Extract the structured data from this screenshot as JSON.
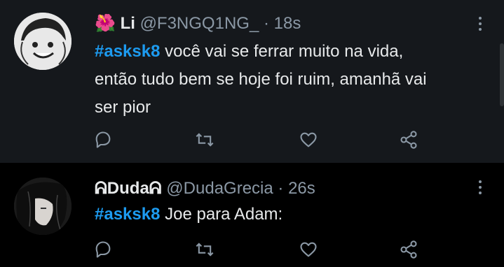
{
  "tweets": [
    {
      "emoji": "🌺",
      "display_name": "Li",
      "handle": "@F3NGQ1NG_",
      "separator": "·",
      "time": "18s",
      "hashtag": "#asksk8",
      "lines": [
        "você vai se ferrar muito na vida,",
        "então tudo bem se hoje foi ruim, amanhã vai",
        "ser pior"
      ]
    },
    {
      "display_name": "ᕱDudaᕱ",
      "handle": "@DudaGrecia",
      "separator": "·",
      "time": "26s",
      "hashtag": "#asksk8",
      "lines": [
        "Joe para Adam:"
      ]
    }
  ],
  "icons": {
    "reply": "reply-icon",
    "retweet": "retweet-icon",
    "like": "heart-icon",
    "share": "share-icon",
    "more": "more-icon"
  },
  "colors": {
    "background": "#15181c",
    "text": "#e7e9ea",
    "secondary": "#8b98a5",
    "accent": "#1d9bf0"
  }
}
